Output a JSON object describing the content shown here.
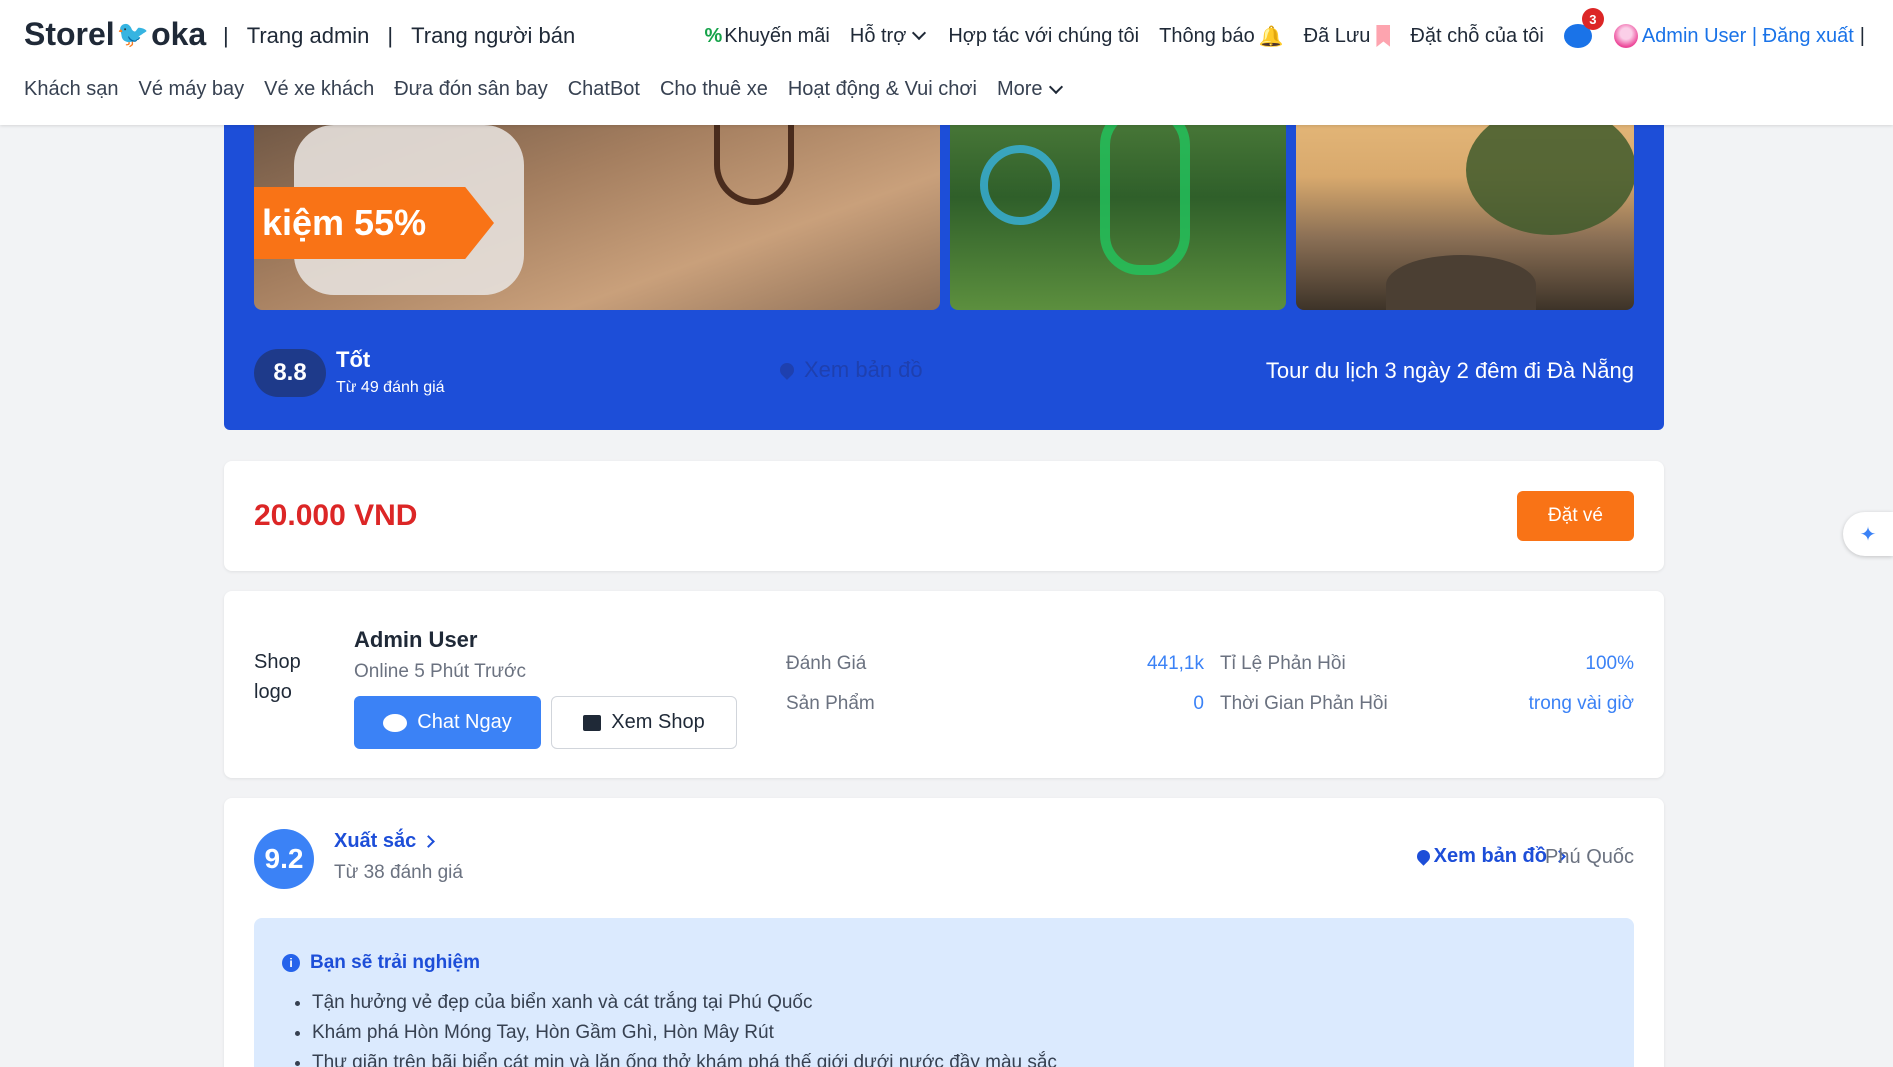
{
  "header": {
    "brand_left": "Storel",
    "brand_right": "oka",
    "top_left": [
      "Trang admin",
      "Trang người bán"
    ],
    "promo": "Khuyến mãi",
    "support": "Hỗ trợ",
    "partner": "Hợp tác với chúng tôi",
    "notify": "Thông báo",
    "saved": "Đã Lưu",
    "bookings": "Đặt chỗ của tôi",
    "msg_count": "3",
    "admin_label": "Admin User | Đăng xuất",
    "trailing_bar": "|"
  },
  "subnav": [
    "Khách sạn",
    "Vé máy bay",
    "Vé xe khách",
    "Đưa đón sân bay",
    "ChatBot",
    "Cho thuê xe",
    "Hoạt động & Vui chơi",
    "More"
  ],
  "hero": {
    "discount": "kiệm 55%",
    "score": "8.8",
    "rating_label": "Tốt",
    "rating_count": "Từ 49 đánh giá",
    "map_text": "Xem bản đồ",
    "title": "Tour du lịch 3 ngày 2 đêm đi Đà Nẵng"
  },
  "price": {
    "amount": "20.000 VND",
    "book": "Đặt vé"
  },
  "seller": {
    "logo_alt": "Shop logo",
    "name": "Admin User",
    "status": "Online 5 Phút Trước",
    "chat": "Chat Ngay",
    "shop": "Xem Shop",
    "stats": {
      "rating_label": "Đánh Giá",
      "rating_value": "441,1k",
      "response_rate_label": "Tỉ Lệ Phản Hồi",
      "response_rate_value": "100%",
      "products_label": "Sản Phẩm",
      "products_value": "0",
      "response_time_label": "Thời Gian Phản Hồi",
      "response_time_value": "trong vài giờ"
    }
  },
  "rating": {
    "score": "9.2",
    "label": "Xuất sắc",
    "count": "Từ 38 đánh giá",
    "map_link": "Xem bản đồ",
    "location": "Phú Quốc"
  },
  "experience": {
    "title": "Bạn sẽ trải nghiệm",
    "items": [
      "Tận hưởng vẻ đẹp của biển xanh và cát trắng tại Phú Quốc",
      "Khám phá Hòn Móng Tay, Hòn Gầm Ghì, Hòn Mây Rút",
      "Thư giãn trên bãi biển cát mịn và lặn ống thở khám phá thế giới dưới nước đầy màu sắc"
    ]
  }
}
